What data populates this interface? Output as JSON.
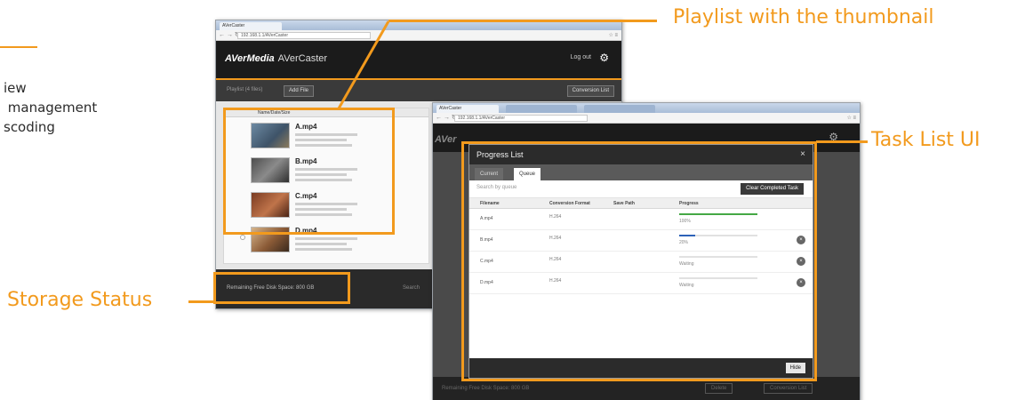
{
  "features": [
    "iew",
    " management",
    "scoding"
  ],
  "callouts": {
    "playlist": "Playlist with the thumbnail",
    "task_list": "Task List UI",
    "storage": "Storage Status"
  },
  "colors": {
    "accent": "#f29a1d",
    "appbar": "#1b1b1b"
  },
  "window_a": {
    "tab_label": "AVerCaster",
    "url": "192.168.1.1/AVerCaster",
    "app_brand": "AVerMedia",
    "app_name": "AVerCaster",
    "login_label": "Log out",
    "toolbar_text": "Playlist (4 files)",
    "add_button": "Add File",
    "convert_button": "Conversion List",
    "list_header": "Name/Date/Size",
    "items": [
      {
        "title": "A.mp4"
      },
      {
        "title": "B.mp4"
      },
      {
        "title": "C.mp4"
      },
      {
        "title": "D.mp4"
      }
    ],
    "storage_text": "Remaining Free Disk Space: 800 GB",
    "footer_right": "Search"
  },
  "window_b": {
    "tab_label": "AVerCaster",
    "url": "192.168.1.1/AVerCaster",
    "app_brand": "AVer",
    "footer_left": "Remaining Free Disk Space: 800 GB",
    "footer_btn1": "Delete",
    "footer_btn2": "Conversion List"
  },
  "dialog": {
    "title": "Progress List",
    "tabs": [
      "Current",
      "Queue"
    ],
    "search_label": "Search by queue",
    "clear_button": "Clear Completed Task",
    "columns": [
      "Filename",
      "Conversion Format",
      "Save Path",
      "Progress"
    ],
    "rows": [
      {
        "name": "A.mp4",
        "format": "H.264",
        "progress": 1.0,
        "status": "100%",
        "color": "#45a845"
      },
      {
        "name": "B.mp4",
        "format": "H.264",
        "progress": 0.2,
        "status": "20%",
        "color": "#2d62b8"
      },
      {
        "name": "C.mp4",
        "format": "H.264",
        "progress": 0.0,
        "status": "Waiting",
        "color": "#2d62b8"
      },
      {
        "name": "D.mp4",
        "format": "H.264",
        "progress": 0.0,
        "status": "Waiting",
        "color": "#2d62b8"
      }
    ],
    "hide_button": "Hide"
  }
}
